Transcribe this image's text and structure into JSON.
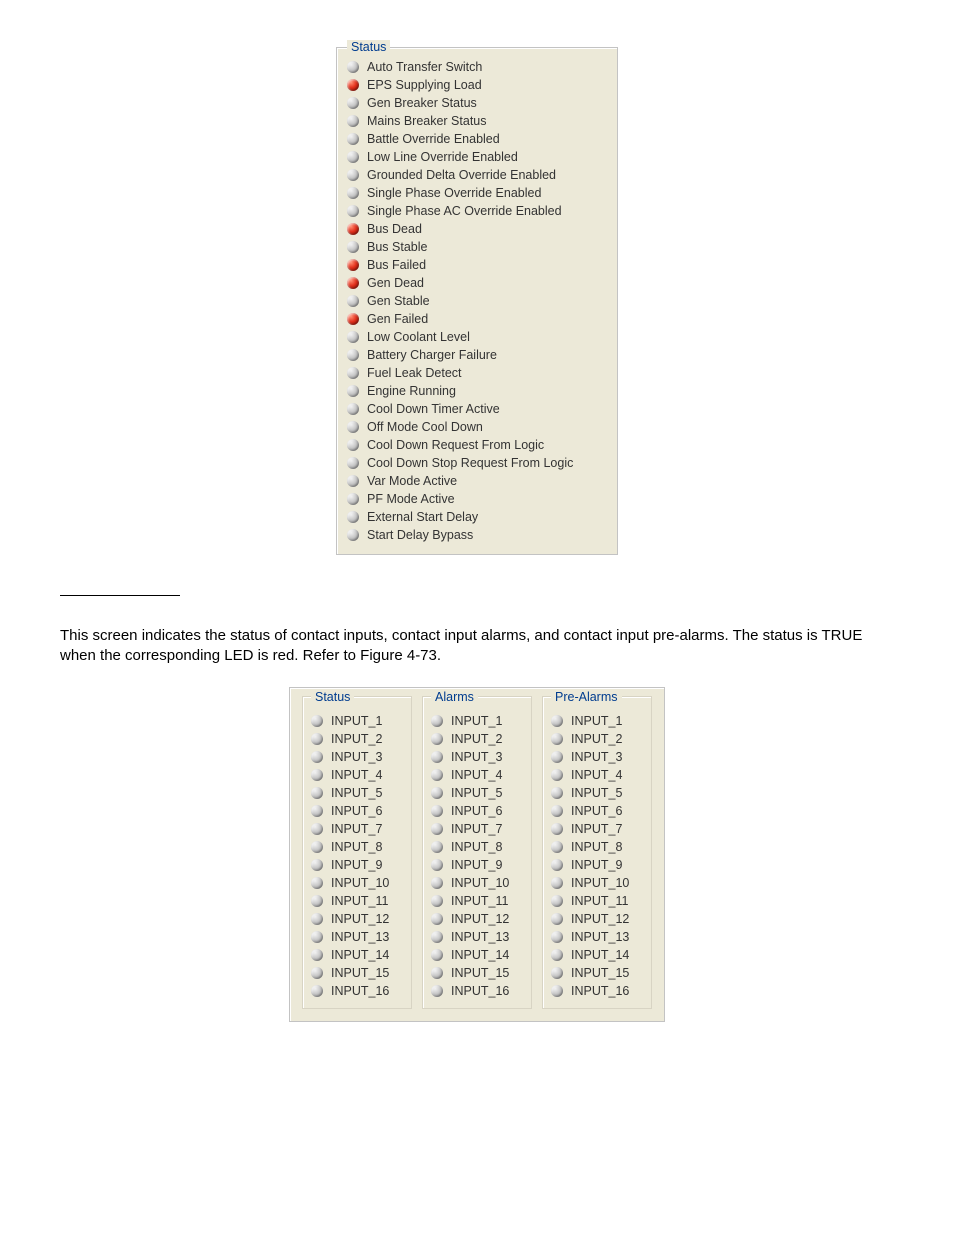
{
  "status_panel": {
    "legend": "Status",
    "items": [
      {
        "label": "Auto Transfer Switch",
        "on": false
      },
      {
        "label": "EPS Supplying Load",
        "on": true
      },
      {
        "label": "Gen Breaker Status",
        "on": false
      },
      {
        "label": "Mains Breaker Status",
        "on": false
      },
      {
        "label": "Battle Override Enabled",
        "on": false
      },
      {
        "label": "Low Line Override Enabled",
        "on": false
      },
      {
        "label": "Grounded Delta Override Enabled",
        "on": false
      },
      {
        "label": "Single Phase Override Enabled",
        "on": false
      },
      {
        "label": "Single Phase AC Override Enabled",
        "on": false
      },
      {
        "label": "Bus Dead",
        "on": true
      },
      {
        "label": "Bus Stable",
        "on": false
      },
      {
        "label": "Bus Failed",
        "on": true
      },
      {
        "label": "Gen Dead",
        "on": true
      },
      {
        "label": "Gen Stable",
        "on": false
      },
      {
        "label": "Gen Failed",
        "on": true
      },
      {
        "label": "Low Coolant Level",
        "on": false
      },
      {
        "label": "Battery Charger Failure",
        "on": false
      },
      {
        "label": "Fuel Leak Detect",
        "on": false
      },
      {
        "label": "Engine Running",
        "on": false
      },
      {
        "label": "Cool Down Timer Active",
        "on": false
      },
      {
        "label": "Off Mode Cool Down",
        "on": false
      },
      {
        "label": "Cool Down Request From Logic",
        "on": false
      },
      {
        "label": "Cool Down Stop Request From Logic",
        "on": false
      },
      {
        "label": "Var Mode Active",
        "on": false
      },
      {
        "label": "PF Mode Active",
        "on": false
      },
      {
        "label": "External Start Delay",
        "on": false
      },
      {
        "label": "Start Delay Bypass",
        "on": false
      }
    ]
  },
  "description": "This screen indicates the status of contact inputs, contact input alarms, and contact input pre-alarms. The status is TRUE when the corresponding LED is red. Refer to Figure 4-73.",
  "inputs_panel": {
    "groups": [
      {
        "legend": "Status"
      },
      {
        "legend": "Alarms"
      },
      {
        "legend": "Pre-Alarms"
      }
    ],
    "items": [
      {
        "label": "INPUT_1"
      },
      {
        "label": "INPUT_2"
      },
      {
        "label": "INPUT_3"
      },
      {
        "label": "INPUT_4"
      },
      {
        "label": "INPUT_5"
      },
      {
        "label": "INPUT_6"
      },
      {
        "label": "INPUT_7"
      },
      {
        "label": "INPUT_8"
      },
      {
        "label": "INPUT_9"
      },
      {
        "label": "INPUT_10"
      },
      {
        "label": "INPUT_11"
      },
      {
        "label": "INPUT_12"
      },
      {
        "label": "INPUT_13"
      },
      {
        "label": "INPUT_14"
      },
      {
        "label": "INPUT_15"
      },
      {
        "label": "INPUT_16"
      }
    ]
  }
}
